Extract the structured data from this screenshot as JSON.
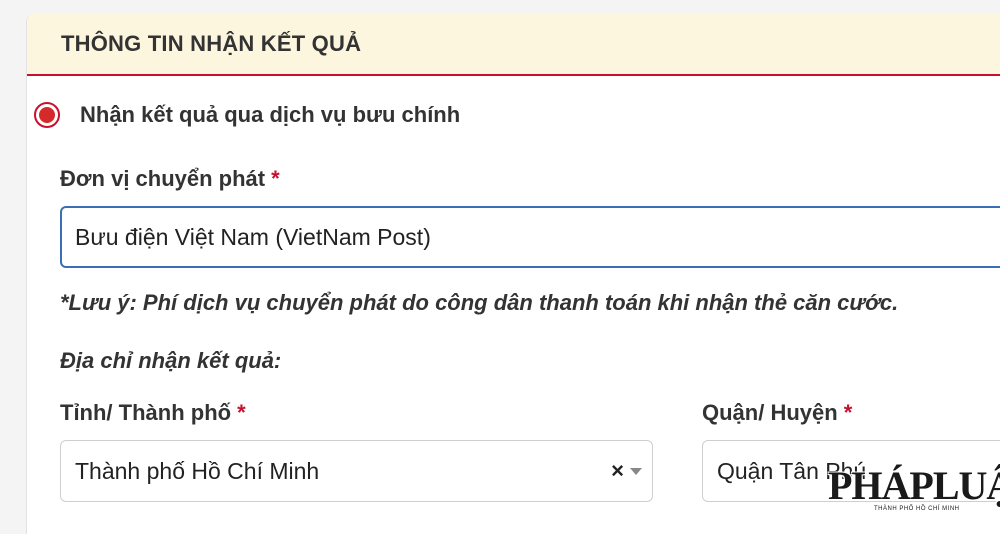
{
  "section": {
    "title": "THÔNG TIN NHẬN KẾT QUẢ"
  },
  "delivery_option": {
    "label": "Nhận kết quả qua dịch vụ bưu chính",
    "selected": true
  },
  "carrier": {
    "label": "Đơn vị chuyển phát",
    "required_mark": "*",
    "value": "Bưu điện Việt Nam (VietNam Post)"
  },
  "note": "*Lưu ý: Phí dịch vụ chuyển phát do công dân thanh toán khi nhận thẻ căn cước.",
  "address": {
    "label": "Địa chỉ nhận kết quả:"
  },
  "province": {
    "label": "Tỉnh/ Thành phố",
    "required_mark": "*",
    "value": "Thành phố Hồ Chí Minh",
    "clear_symbol": "×"
  },
  "district": {
    "label": "Quận/ Huyện",
    "required_mark": "*",
    "value": "Quận Tân Phú"
  },
  "watermark": {
    "text": "PHÁPLUẬT",
    "subtext": "THÀNH PHỐ HỒ CHÍ MINH"
  },
  "colors": {
    "accent_red": "#c8102e",
    "focus_blue": "#3a6fb8",
    "header_bg": "#fdf6df"
  }
}
